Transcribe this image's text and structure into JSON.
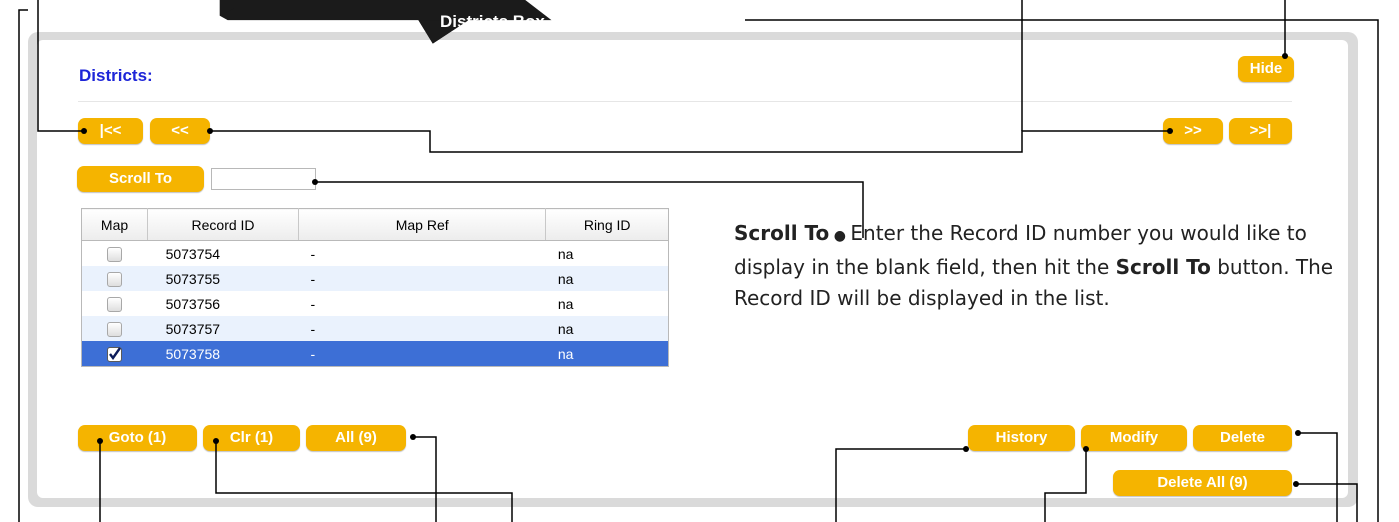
{
  "banner": {
    "title": "Districts Box"
  },
  "panel": {
    "title": "Districts:",
    "hide_label": "Hide"
  },
  "nav": {
    "first_label": "|<<",
    "prev_label": "<<",
    "next_label": ">>",
    "last_label": ">>|"
  },
  "scroll": {
    "button_label": "Scroll To",
    "input_value": ""
  },
  "table": {
    "headers": [
      "Map",
      "Record ID",
      "Map Ref",
      "Ring ID"
    ],
    "rows": [
      {
        "checked": false,
        "record_id": "5073754",
        "map_ref": "-",
        "ring_id": "na"
      },
      {
        "checked": false,
        "record_id": "5073755",
        "map_ref": "-",
        "ring_id": "na"
      },
      {
        "checked": false,
        "record_id": "5073756",
        "map_ref": "-",
        "ring_id": "na"
      },
      {
        "checked": false,
        "record_id": "5073757",
        "map_ref": "-",
        "ring_id": "na"
      },
      {
        "checked": true,
        "record_id": "5073758",
        "map_ref": "-",
        "ring_id": "na",
        "selected": true
      }
    ]
  },
  "actions": {
    "goto_label": "Goto (1)",
    "clr_label": "Clr (1)",
    "all_label": "All (9)",
    "history_label": "History",
    "modify_label": "Modify",
    "delete_label": "Delete",
    "delete_all_label": "Delete All (9)"
  },
  "help": {
    "term": "Scroll To",
    "text_1": " Enter the Record ID number you would like to display in the blank field, then hit the ",
    "term_2": "Scroll To",
    "text_2": " button. The Record ID will be displayed in the list."
  },
  "colors": {
    "accent": "#f5b400",
    "title_blue": "#1d25d8",
    "selection": "#3d6fd6",
    "banner": "#1b1b1b"
  }
}
